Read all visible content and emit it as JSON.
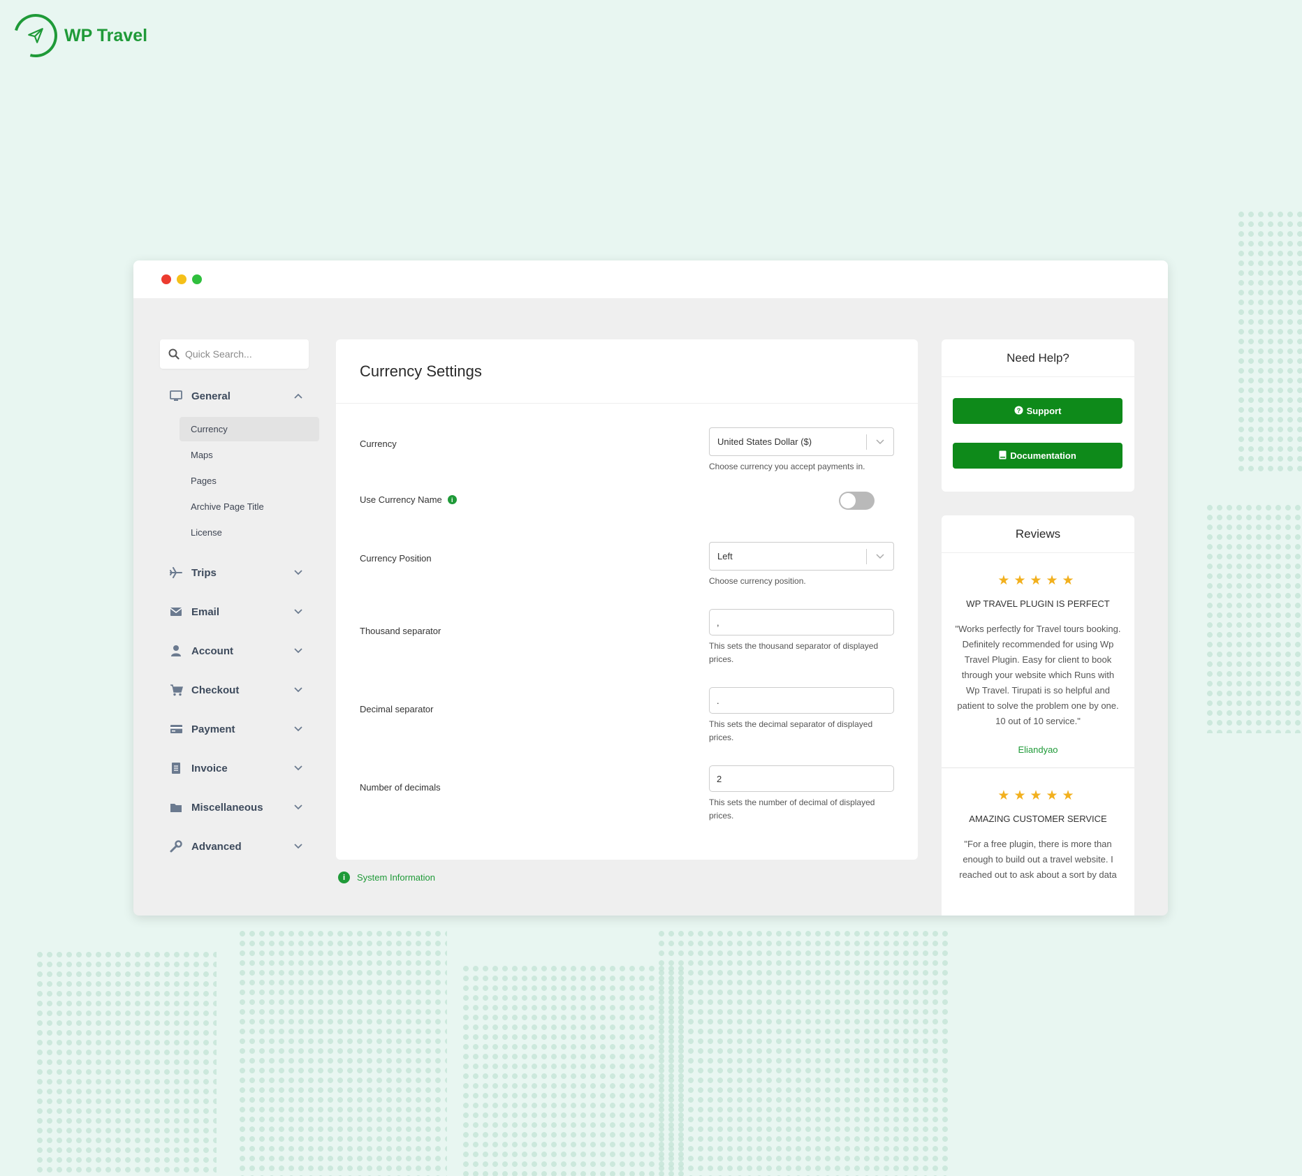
{
  "brand": {
    "name": "WP Travel"
  },
  "search": {
    "placeholder": "Quick Search..."
  },
  "sidebar": {
    "groups": [
      {
        "label": "General",
        "icon": "monitor-icon",
        "expanded": true,
        "items": [
          "Currency",
          "Maps",
          "Pages",
          "Archive Page Title",
          "License"
        ],
        "active_item": "Currency"
      },
      {
        "label": "Trips",
        "icon": "plane-icon"
      },
      {
        "label": "Email",
        "icon": "envelope-icon"
      },
      {
        "label": "Account",
        "icon": "user-icon"
      },
      {
        "label": "Checkout",
        "icon": "cart-icon"
      },
      {
        "label": "Payment",
        "icon": "credit-card-icon"
      },
      {
        "label": "Invoice",
        "icon": "invoice-icon"
      },
      {
        "label": "Miscellaneous",
        "icon": "folder-icon"
      },
      {
        "label": "Advanced",
        "icon": "wrench-icon"
      }
    ]
  },
  "main": {
    "title": "Currency Settings",
    "fields": {
      "currency": {
        "label": "Currency",
        "value": "United States Dollar ($)",
        "hint": "Choose currency you accept payments in."
      },
      "use_currency_name": {
        "label": "Use Currency Name",
        "value": false
      },
      "currency_position": {
        "label": "Currency Position",
        "value": "Left",
        "hint": "Choose currency position."
      },
      "thousand_separator": {
        "label": "Thousand separator",
        "value": ",",
        "hint": "This sets the thousand separator of displayed prices."
      },
      "decimal_separator": {
        "label": "Decimal separator",
        "value": ".",
        "hint": "This sets the decimal separator of displayed prices."
      },
      "number_of_decimals": {
        "label": "Number of decimals",
        "value": "2",
        "hint": "This sets the number of decimal of displayed prices."
      }
    },
    "system_info": "System Information"
  },
  "help": {
    "title": "Need Help?",
    "support_label": "Support",
    "docs_label": "Documentation"
  },
  "reviews": {
    "title": "Reviews",
    "items": [
      {
        "stars": 5,
        "title": "WP TRAVEL PLUGIN IS PERFECT",
        "body": "\"Works perfectly for Travel tours booking. Definitely recommended for using Wp Travel Plugin. Easy for client to book through your website which Runs with Wp Travel. Tirupati is so helpful and patient to solve the problem one by one. 10 out of 10 service.\"",
        "author": "Eliandyao"
      },
      {
        "stars": 5,
        "title": "AMAZING CUSTOMER SERVICE",
        "body": "\"For a free plugin, there is more than enough to build out a travel website. I reached out to ask about a sort by data",
        "author": ""
      }
    ]
  },
  "colors": {
    "accent": "#1f9a38",
    "button": "#0e8a1a",
    "star": "#f2b01e",
    "background": "#e8f6f1"
  }
}
